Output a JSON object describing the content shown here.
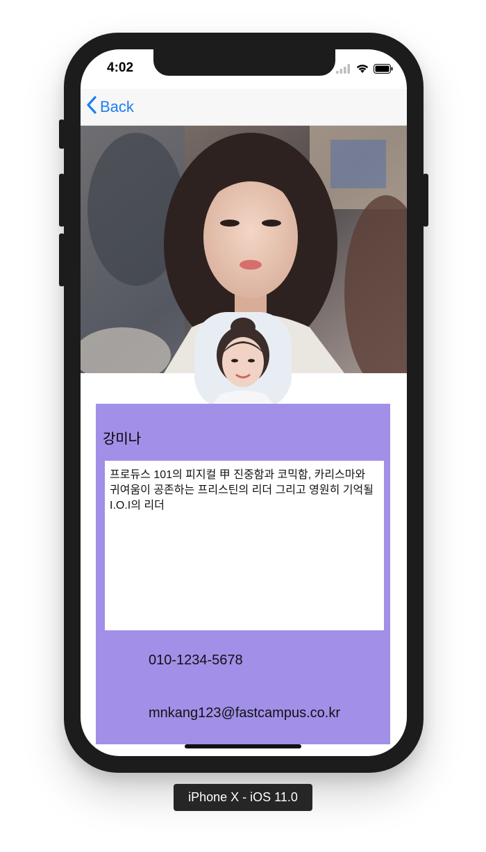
{
  "status_bar": {
    "time": "4:02"
  },
  "navbar": {
    "back_label": "Back"
  },
  "profile": {
    "name": "강미나",
    "bio": "프로듀스 101의 피지컬 甲 진중함과 코믹함, 카리스마와 귀여움이 공존하는 프리스틴의 리더 그리고 영원히 기억될 I.O.I의 리더",
    "phone": "010-1234-5678",
    "email": "mnkang123@fastcampus.co.kr"
  },
  "simulator": {
    "label": "iPhone X - iOS 11.0"
  },
  "colors": {
    "accent": "#1a7ff0",
    "card": "#a28fe8",
    "frame": "#1c1c1c"
  },
  "icons": {
    "back": "chevron-left-icon",
    "signal": "cellular-signal-icon",
    "wifi": "wifi-icon",
    "battery": "battery-icon"
  }
}
